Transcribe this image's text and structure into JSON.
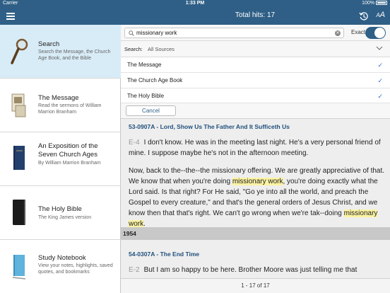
{
  "status": {
    "carrier": "Carrier",
    "time": "1:33 PM",
    "battery": "100%"
  },
  "nav": {
    "title": "Total hits: 17"
  },
  "sidebar": {
    "items": [
      {
        "title": "Search",
        "desc": "Search the Message, the Church Age Book, and the Bible"
      },
      {
        "title": "The Message",
        "desc": "Read the sermons of William Marrion Branham"
      },
      {
        "title": "An Exposition of the Seven Church Ages",
        "desc": "By William Marrion Branham"
      },
      {
        "title": "The Holy Bible",
        "desc": "The King James version"
      },
      {
        "title": "Study Notebook",
        "desc": "View your notes, highlights, saved quotes, and bookmarks"
      }
    ]
  },
  "search": {
    "value": "missionary work",
    "exact_label": "Exact",
    "exact_on": true
  },
  "scope": {
    "label": "Search:",
    "value": "All Sources"
  },
  "sources": [
    {
      "label": "The Message",
      "checked": true
    },
    {
      "label": "The Church Age Book",
      "checked": true
    },
    {
      "label": "The Holy Bible",
      "checked": true
    }
  ],
  "cancel_label": "Cancel",
  "results": {
    "sermon1": {
      "title": "53-0907A - Lord, Show Us The Father And It Sufficeth Us",
      "p1_num": "E-4",
      "p1_text": "I don't know. He was in the meeting last night. He's a very personal friend of mine. I suppose maybe he's not in the afternoon meeting.",
      "p2_a": "Now, back to the--the--the missionary offering. We are greatly appreciative of that. We know that when you're doing ",
      "p2_hl1": "missionary work",
      "p2_b": ", you're doing exactly what the Lord said. Is that right? For He said, \"Go ye into all the world, and preach the Gospel to every creature,\" and that's the general orders of Jesus Christ, and we know then that that's right. We can't go wrong when we're tak--doing ",
      "p2_hl2": "missionary work",
      "p2_c": "."
    },
    "year": "1954",
    "sermon2": {
      "title": "54-0307A - The End Time",
      "p1_num": "E-2",
      "p1_text": "But I am so happy to be here. Brother Moore was just telling me that"
    }
  },
  "footer": {
    "range": "1 - 17 of 17"
  },
  "colors": {
    "accent": "#2f5f86",
    "highlight": "#fbf3a2",
    "selected": "#d8ecf7"
  }
}
